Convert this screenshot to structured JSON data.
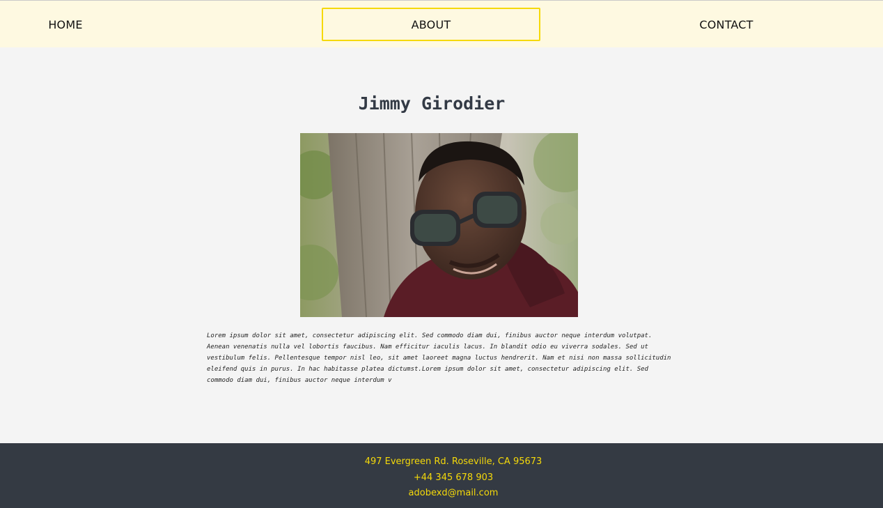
{
  "nav": {
    "home": "HOME",
    "about": "ABOUT",
    "contact": "CONTACT",
    "active_color": "#f5d90a",
    "background": "#fef9e1"
  },
  "profile": {
    "name": "Jimmy Girodier",
    "photo_icon": "portrait-photo",
    "bio": "Lorem ipsum dolor sit amet, consectetur adipiscing elit. Sed commodo diam dui, finibus auctor neque interdum volutpat. Aenean venenatis nulla vel lobortis faucibus. Nam efficitur iaculis lacus. In blandit odio eu viverra sodales. Sed ut vestibulum felis. Pellentesque tempor nisl leo, sit amet laoreet magna luctus hendrerit. Nam et nisi non massa sollicitudin eleifend quis in purus. In hac habitasse platea dictumst.Lorem ipsum dolor sit amet, consectetur adipiscing elit. Sed commodo diam dui, finibus auctor neque interdum v"
  },
  "footer": {
    "address": "497 Evergreen Rd. Roseville, CA 95673",
    "phone": "+44 345 678 903",
    "email": "adobexd@mail.com",
    "background": "#343a43",
    "text_color": "#f5d90a"
  }
}
